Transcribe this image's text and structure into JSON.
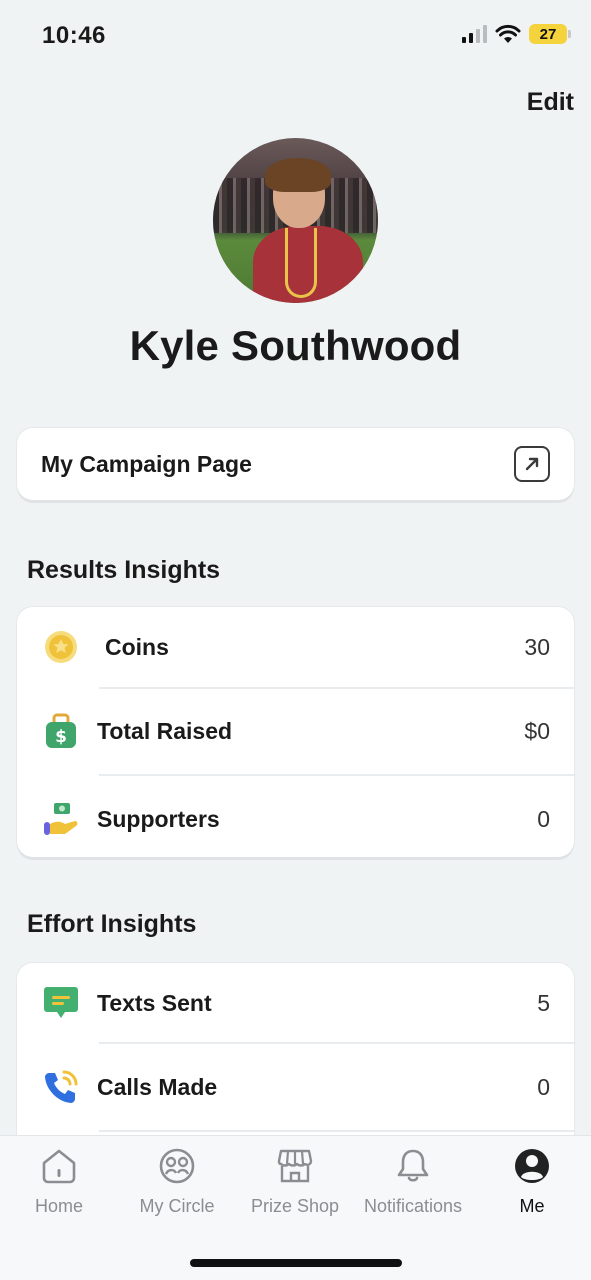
{
  "status_bar": {
    "time": "10:46",
    "battery": "27"
  },
  "header": {
    "edit_label": "Edit"
  },
  "profile": {
    "name": "Kyle Southwood"
  },
  "campaign": {
    "label": "My Campaign Page"
  },
  "results": {
    "title": "Results Insights",
    "rows": [
      {
        "label": "Coins",
        "value": "30",
        "icon": "coin-icon"
      },
      {
        "label": "Total Raised",
        "value": "$0",
        "icon": "money-bag-icon"
      },
      {
        "label": "Supporters",
        "value": "0",
        "icon": "supporters-hand-icon"
      }
    ]
  },
  "effort": {
    "title": "Effort Insights",
    "rows": [
      {
        "label": "Texts Sent",
        "value": "5",
        "icon": "chat-bubble-icon"
      },
      {
        "label": "Calls Made",
        "value": "0",
        "icon": "phone-icon"
      }
    ]
  },
  "tabs": [
    {
      "label": "Home",
      "icon": "home-icon"
    },
    {
      "label": "My Circle",
      "icon": "circle-group-icon"
    },
    {
      "label": "Prize Shop",
      "icon": "store-icon"
    },
    {
      "label": "Notifications",
      "icon": "bell-icon"
    },
    {
      "label": "Me",
      "icon": "profile-icon",
      "active": true
    }
  ],
  "colors": {
    "background": "#f0f3f4",
    "coin": "#f3c94a",
    "bag": "#3fa56b",
    "chat": "#44b06f",
    "phone": "#2f6fe0"
  }
}
